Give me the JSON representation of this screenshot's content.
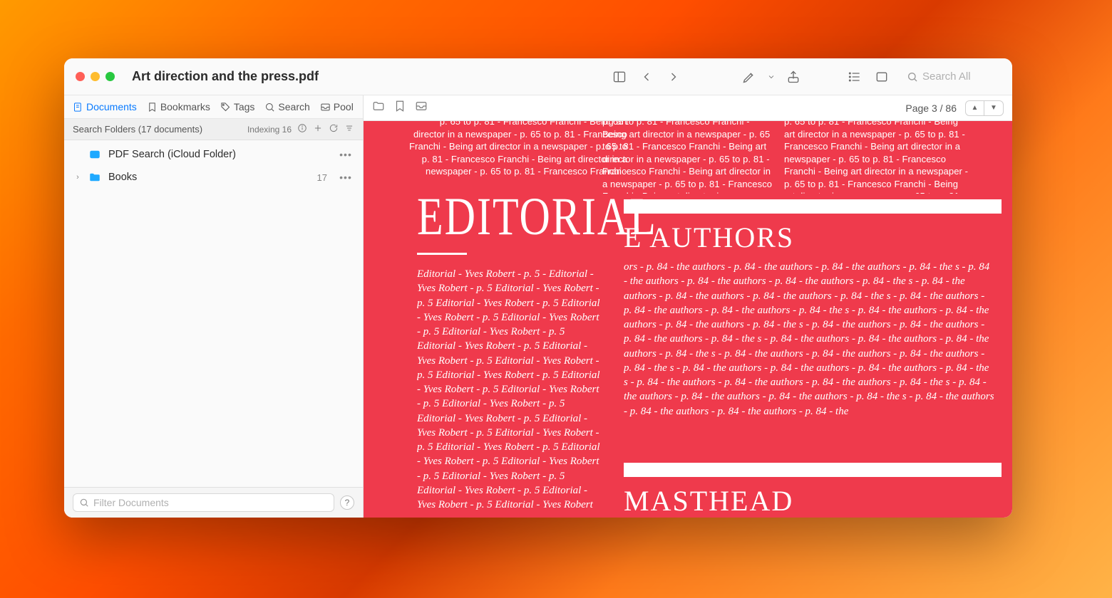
{
  "window": {
    "title": "Art direction and the press.pdf"
  },
  "toolbar": {
    "search_placeholder": "Search All"
  },
  "sidebar": {
    "tabs": [
      {
        "label": "Documents",
        "active": true
      },
      {
        "label": "Bookmarks"
      },
      {
        "label": "Tags"
      },
      {
        "label": "Search"
      },
      {
        "label": "Pool"
      }
    ],
    "header": {
      "label": "Search Folders (17 documents)",
      "indexing": "Indexing 16"
    },
    "items": [
      {
        "label": "PDF Search (iCloud Folder)",
        "kind": "app",
        "count": "",
        "expandable": false
      },
      {
        "label": "Books",
        "kind": "folder",
        "count": "17",
        "expandable": true
      }
    ],
    "filter_placeholder": "Filter Documents"
  },
  "doc": {
    "page_indicator": "Page 3 / 86",
    "headings": {
      "editorial": "EDITORIAL",
      "authors": "E AUTHORS",
      "masthead": "MASTHEAD"
    },
    "strip_text": "p. 65 to p. 81 - Francesco Franchi - Being art director in a newspaper - p. 65 to p. 81 - Francesco Franchi - Being art director in a newspaper - p. 65 to p. 81 - Francesco Franchi - Being art director in a newspaper - p. 65 to p. 81 - Francesco Franchi - Being art director in a newspaper - p. 65 to p. 81 - Francesco Franchi - Being art director in a newspaper - p. 65 to p. 81 - Francesco",
    "editorial_body": "Editorial - Yves Robert - p. 5 - Editorial - Yves Robert - p. 5 Editorial - Yves Robert - p. 5 Editorial - Yves Robert - p. 5 Editorial - Yves Robert - p. 5 Editorial - Yves Robert - p. 5 Editorial - Yves Robert - p. 5 Editorial - Yves Robert - p. 5 Editorial - Yves Robert - p. 5 Editorial - Yves Robert - p. 5 Editorial - Yves Robert - p. 5 Editorial - Yves Robert - p. 5 Editorial - Yves Robert - p. 5 Editorial - Yves Robert - p. 5 Editorial - Yves Robert - p. 5 Editorial - Yves Robert - p. 5 Editorial - Yves Robert - p. 5 Editorial - Yves Robert - p. 5 Editorial - Yves Robert - p. 5 Editorial - Yves Robert - p. 5 Editorial - Yves Robert - p. 5 Editorial - Yves Robert - p. 5 Editorial - Yves Robert - p. 5 Editorial - Yves Robert",
    "authors_body": "ors - p. 84 - the authors - p. 84 - the authors - p. 84 - the authors - p. 84 - the s - p. 84 - the authors - p. 84 - the authors - p. 84 - the authors - p. 84 - the s - p. 84 - the authors - p. 84 - the authors - p. 84 - the authors - p. 84 - the s - p. 84 - the authors - p. 84 - the authors - p. 84 - the authors - p. 84 - the s - p. 84 - the authors - p. 84 - the authors - p. 84 - the authors - p. 84 - the s - p. 84 - the authors - p. 84 - the authors - p. 84 - the authors - p. 84 - the s - p. 84 - the authors - p. 84 - the authors - p. 84 - the authors - p. 84 - the s - p. 84 - the authors - p. 84 - the authors - p. 84 - the authors - p. 84 - the s - p. 84 - the authors - p. 84 - the authors - p. 84 - the authors - p. 84 - the s - p. 84 - the authors - p. 84 - the authors - p. 84 - the authors - p. 84 - the s - p. 84 - the authors - p. 84 - the authors - p. 84 - the authors - p. 84 - the s - p. 84 - the authors - p. 84 - the authors - p. 84 - the authors - p. 84 - the"
  }
}
